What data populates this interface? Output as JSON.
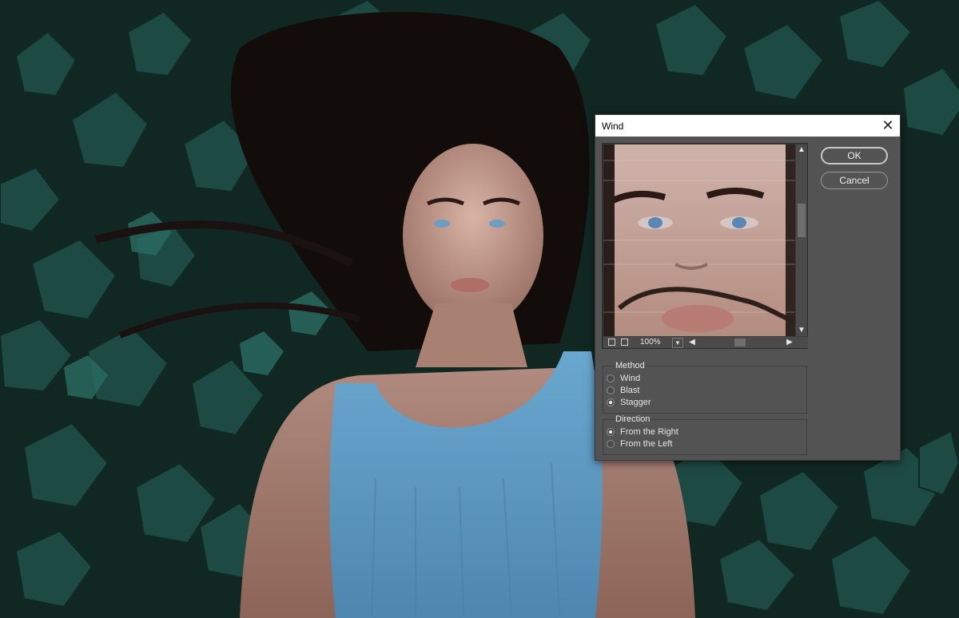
{
  "dialog": {
    "title": "Wind",
    "close_icon": "close-icon",
    "ok_label": "OK",
    "cancel_label": "Cancel",
    "preview": {
      "zoom": "100%",
      "icons": [
        "zoom-out-icon",
        "zoom-in-icon",
        "chevron-down-icon",
        "arrow-left-icon",
        "arrow-right-icon",
        "arrow-up-icon",
        "arrow-down-icon"
      ]
    },
    "method": {
      "title": "Method",
      "options": [
        {
          "label": "Wind",
          "selected": false
        },
        {
          "label": "Blast",
          "selected": false
        },
        {
          "label": "Stagger",
          "selected": true
        }
      ]
    },
    "direction": {
      "title": "Direction",
      "options": [
        {
          "label": "From the Right",
          "selected": true
        },
        {
          "label": "From the Left",
          "selected": false
        }
      ]
    }
  },
  "colors": {
    "dialog_bg": "#535353",
    "titlebar_bg": "#ffffff",
    "ivy_leaf": "#1f4f48",
    "dress_blue": "#5f9cc4"
  }
}
